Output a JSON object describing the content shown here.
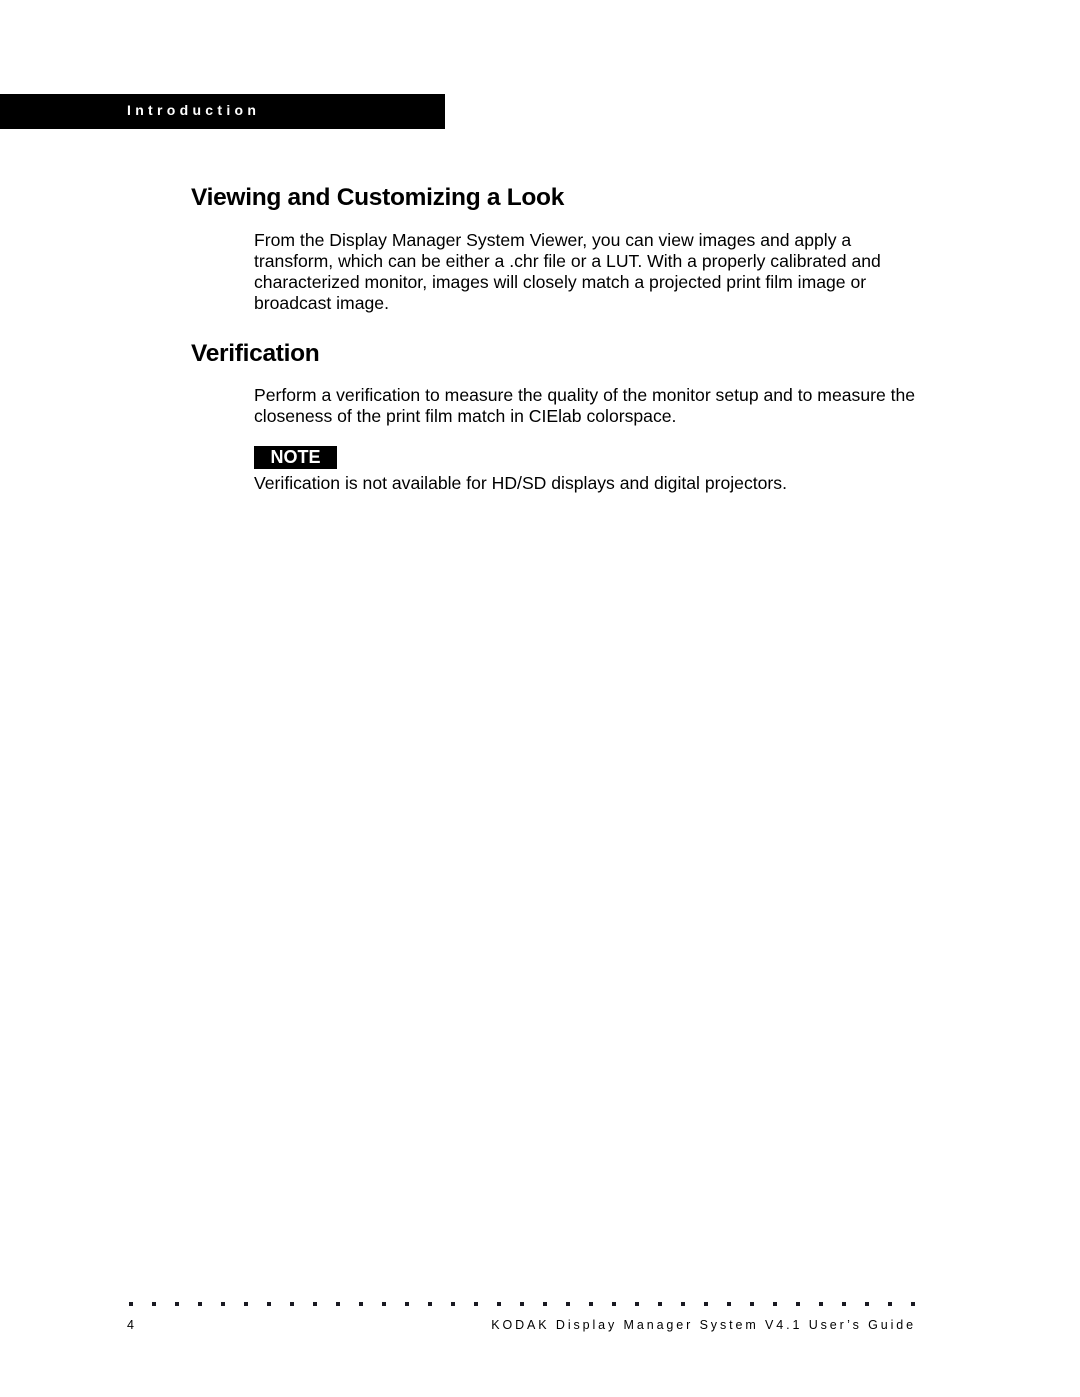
{
  "header": {
    "section_label": "Introduction"
  },
  "sections": [
    {
      "heading": "Viewing and Customizing a Look",
      "paragraphs": [
        "From the Display Manager System Viewer, you can view images and apply a transform, which can be either a .chr file or a LUT. With a properly calibrated and characterized monitor, images will closely match a projected print film image or broadcast image."
      ]
    },
    {
      "heading": "Verification",
      "paragraphs": [
        "Perform a verification to measure the quality of the monitor setup and to measure the closeness of the print film match in CIElab colorspace."
      ],
      "note": {
        "label": "NOTE",
        "text": "Verification is not available for HD/SD displays and digital projectors."
      }
    }
  ],
  "footer": {
    "page_number": "4",
    "title": "KODAK Display Manager System V4.1 User’s Guide",
    "dot_count": 35
  }
}
